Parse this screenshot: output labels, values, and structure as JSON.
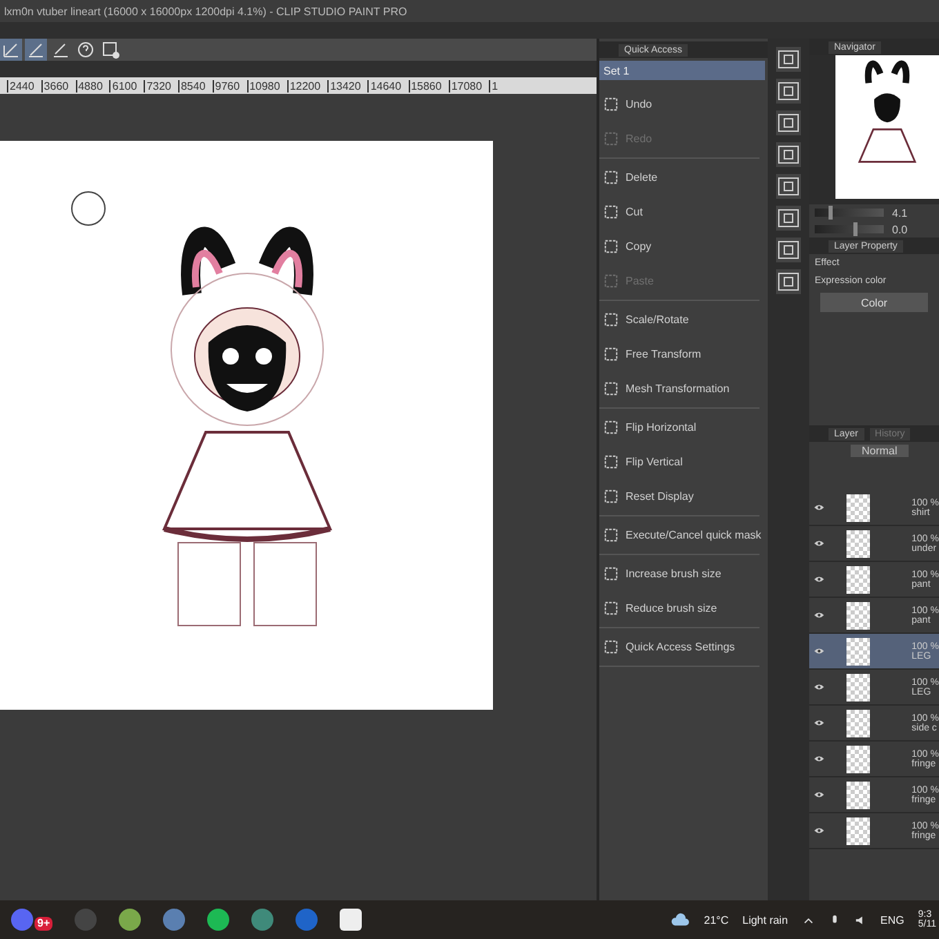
{
  "window": {
    "title": "lxm0n vtuber lineart (16000 x 16000px 1200dpi 4.1%)  - CLIP STUDIO PAINT PRO"
  },
  "ruler": {
    "labels": [
      "2440",
      "3660",
      "4880",
      "6100",
      "7320",
      "8540",
      "9760",
      "10980",
      "12200",
      "13420",
      "14640",
      "15860",
      "17080",
      "1"
    ]
  },
  "quick_access": {
    "tab": "Quick Access",
    "set": "Set 1",
    "groups": [
      [
        {
          "label": "Undo",
          "disabled": false
        },
        {
          "label": "Redo",
          "disabled": true
        }
      ],
      [
        {
          "label": "Delete",
          "disabled": false
        },
        {
          "label": "Cut",
          "disabled": false
        },
        {
          "label": "Copy",
          "disabled": false
        },
        {
          "label": "Paste",
          "disabled": true
        }
      ],
      [
        {
          "label": "Scale/Rotate",
          "disabled": false
        },
        {
          "label": "Free Transform",
          "disabled": false
        },
        {
          "label": "Mesh Transformation",
          "disabled": false
        }
      ],
      [
        {
          "label": "Flip Horizontal",
          "disabled": false
        },
        {
          "label": "Flip Vertical",
          "disabled": false
        },
        {
          "label": "Reset Display",
          "disabled": false
        }
      ],
      [
        {
          "label": "Execute/Cancel quick mask",
          "disabled": false
        }
      ],
      [
        {
          "label": "Increase brush size",
          "disabled": false
        },
        {
          "label": "Reduce brush size",
          "disabled": false
        }
      ],
      [
        {
          "label": "Quick Access Settings",
          "disabled": false
        }
      ]
    ]
  },
  "navigator": {
    "tab": "Navigator",
    "zoom": "4.1",
    "zoom_slider": {
      "level": 0.2
    },
    "rotation": "0.0",
    "rotation_slider": {
      "level": 0.55
    }
  },
  "layer_property": {
    "tab": "Layer Property",
    "effect": "Effect",
    "expression_color": "Expression color",
    "color_button": "Color"
  },
  "layers": {
    "tab": "Layer",
    "tab_2": "History",
    "blend_mode": "Normal",
    "rows": [
      {
        "opacity": "100 %",
        "name": "shirt",
        "selected": false
      },
      {
        "opacity": "100 %",
        "name": "under",
        "selected": false
      },
      {
        "opacity": "100 %",
        "name": "pant",
        "selected": false
      },
      {
        "opacity": "100 %",
        "name": "pant",
        "selected": false
      },
      {
        "opacity": "100 %",
        "name": "LEG",
        "selected": true
      },
      {
        "opacity": "100 %",
        "name": "LEG",
        "selected": false
      },
      {
        "opacity": "100 %",
        "name": "side c",
        "selected": false
      },
      {
        "opacity": "100 %",
        "name": "fringe",
        "selected": false
      },
      {
        "opacity": "100 %",
        "name": "fringe",
        "selected": false
      },
      {
        "opacity": "100 %",
        "name": "fringe",
        "selected": false
      }
    ]
  },
  "taskbar": {
    "badge": "9+",
    "temperature": "21°C",
    "weather": "Light rain",
    "language": "ENG",
    "time": "9:3",
    "date": "5/11"
  }
}
